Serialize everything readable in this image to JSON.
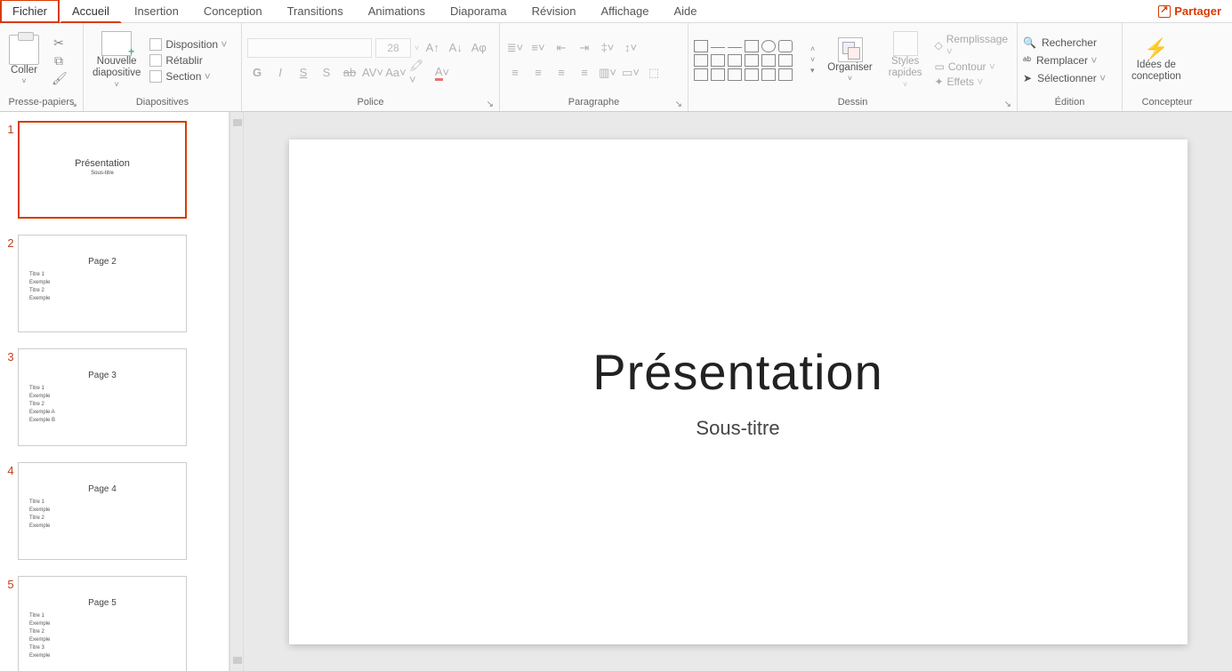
{
  "tabs": {
    "fichier": "Fichier",
    "accueil": "Accueil",
    "insertion": "Insertion",
    "conception": "Conception",
    "transitions": "Transitions",
    "animations": "Animations",
    "diaporama": "Diaporama",
    "revision": "Révision",
    "affichage": "Affichage",
    "aide": "Aide"
  },
  "share": "Partager",
  "groups": {
    "clipboard": {
      "label": "Presse-papiers",
      "paste": "Coller"
    },
    "slides": {
      "label": "Diapositives",
      "new_slide": "Nouvelle\ndiapositive",
      "disposition": "Disposition",
      "retablira": "Rétablir",
      "section": "Section"
    },
    "font": {
      "label": "Police",
      "size": "28"
    },
    "paragraph": {
      "label": "Paragraphe"
    },
    "drawing": {
      "label": "Dessin",
      "organiser": "Organiser",
      "styles": "Styles\nrapides",
      "remplissage": "Remplissage",
      "contour": "Contour",
      "effets": "Effets"
    },
    "editing": {
      "label": "Édition",
      "rechercher": "Rechercher",
      "remplacer": "Remplacer",
      "selectionner": "Sélectionner"
    },
    "designer": {
      "label": "Concepteur",
      "idees": "Idées de\nconception"
    }
  },
  "thumbnails": [
    {
      "num": "1",
      "title": "Présentation",
      "sub": "Sous-titre",
      "selected": true
    },
    {
      "num": "2",
      "title": "Page 2",
      "lines": [
        "Titre 1",
        "Exemple",
        "Titre 2",
        "Exemple"
      ]
    },
    {
      "num": "3",
      "title": "Page 3",
      "lines": [
        "Titre 1",
        "Exemple",
        "Titre 2",
        "Exemple A",
        "Exemple B"
      ]
    },
    {
      "num": "4",
      "title": "Page 4",
      "lines": [
        "Titre 1",
        "Exemple",
        "Titre 2",
        "Exemple"
      ]
    },
    {
      "num": "5",
      "title": "Page 5",
      "lines": [
        "Titre 1",
        "Exemple",
        "Titre 2",
        "Exemple",
        "Titre 3",
        "Exemple"
      ]
    }
  ],
  "current_slide": {
    "title": "Présentation",
    "subtitle": "Sous-titre"
  }
}
